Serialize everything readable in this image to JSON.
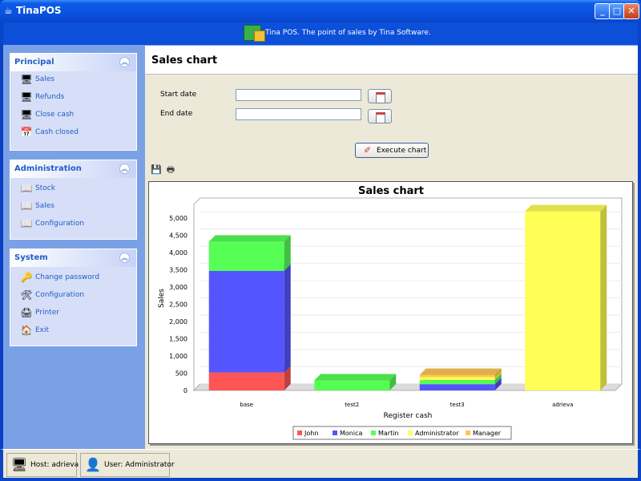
{
  "window": {
    "title": "TinaPOS"
  },
  "banner": {
    "text": "Tina POS. The point of sales by Tina Software."
  },
  "sidebar": {
    "principal": {
      "title": "Principal",
      "items": [
        {
          "label": "Sales",
          "icon": "sales-icon"
        },
        {
          "label": "Refunds",
          "icon": "refunds-icon"
        },
        {
          "label": "Close cash",
          "icon": "close-cash-icon"
        },
        {
          "label": "Cash closed",
          "icon": "cash-closed-icon"
        }
      ]
    },
    "administration": {
      "title": "Administration",
      "items": [
        {
          "label": "Stock",
          "icon": "stock-icon"
        },
        {
          "label": "Sales",
          "icon": "sales-report-icon"
        },
        {
          "label": "Configuration",
          "icon": "configuration-icon"
        }
      ]
    },
    "system": {
      "title": "System",
      "items": [
        {
          "label": "Change password",
          "icon": "key-icon"
        },
        {
          "label": "Configuration",
          "icon": "tools-icon"
        },
        {
          "label": "Printer",
          "icon": "printer-icon"
        },
        {
          "label": "Exit",
          "icon": "exit-icon"
        }
      ]
    }
  },
  "content": {
    "title": "Sales chart",
    "start_date_label": "Start date",
    "start_date_value": "",
    "end_date_label": "End date",
    "end_date_value": "",
    "execute_label": "Execute chart"
  },
  "statusbar": {
    "host": "Host: adrieva",
    "user": "User: Administrator"
  },
  "chart_data": {
    "type": "bar",
    "stacked": true,
    "title": "Sales chart",
    "xlabel": "Register cash",
    "ylabel": "Sales",
    "ylim": [
      0,
      5000
    ],
    "yticks": [
      "0",
      "500",
      "1,000",
      "1,500",
      "2,000",
      "2,500",
      "3,000",
      "3,500",
      "4,000",
      "4,500",
      "5,000"
    ],
    "categories": [
      "base",
      "test2",
      "test3",
      "adrieva"
    ],
    "series": [
      {
        "name": "John",
        "color": "#ff5555",
        "values": [
          520,
          0,
          0,
          0
        ]
      },
      {
        "name": "Monica",
        "color": "#5555ff",
        "values": [
          2950,
          0,
          180,
          0
        ]
      },
      {
        "name": "Martin",
        "color": "#55ff55",
        "values": [
          850,
          290,
          120,
          0
        ]
      },
      {
        "name": "Administrator",
        "color": "#ffff55",
        "values": [
          0,
          0,
          90,
          5200
        ]
      },
      {
        "name": "Manager",
        "color": "#ffc655",
        "values": [
          0,
          0,
          60,
          0
        ]
      }
    ],
    "legend_position": "bottom"
  }
}
